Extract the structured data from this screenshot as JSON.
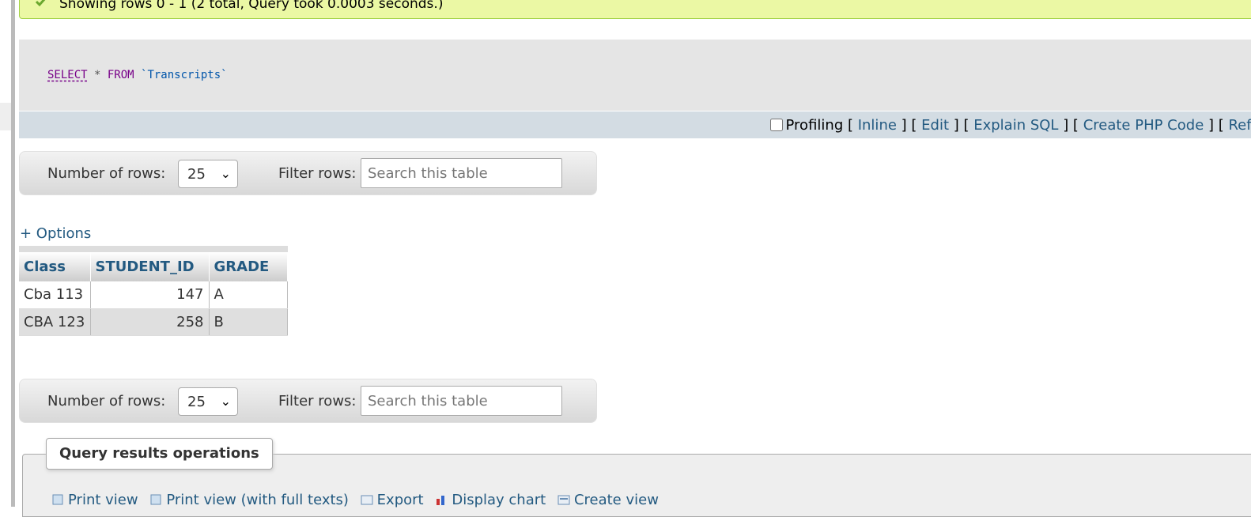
{
  "success": {
    "message": "Showing rows 0 - 1 (2 total, Query took 0.0003 seconds.)"
  },
  "sql": {
    "select": "SELECT",
    "star": " * ",
    "from": "FROM",
    "table": " `Transcripts`"
  },
  "tools": {
    "profiling": "Profiling",
    "inline": "Inline",
    "edit": "Edit",
    "explain": "Explain SQL",
    "php": "Create PHP Code",
    "refresh": "Refr"
  },
  "nav_top": {
    "rows_label": "Number of rows:",
    "rows_value": "25",
    "filter_label": "Filter rows:",
    "search_placeholder": "Search this table"
  },
  "nav_bottom": {
    "rows_label": "Number of rows:",
    "rows_value": "25",
    "filter_label": "Filter rows:",
    "search_placeholder": "Search this table"
  },
  "options_label": "+ Options",
  "table": {
    "headers": [
      "Class",
      "STUDENT_ID",
      "GRADE"
    ],
    "rows": [
      [
        "Cba 113",
        "147",
        "A"
      ],
      [
        "CBA 123",
        "258",
        "B"
      ]
    ]
  },
  "operations": {
    "title": "Query results operations",
    "links": [
      "Print view",
      "Print view (with full texts)",
      "Export",
      "Display chart",
      "Create view"
    ]
  },
  "colors": {
    "link": "#235a81",
    "success_bg": "#ebf8a4",
    "sql_bg": "#e5e5e5",
    "tools_bg": "#d3dce3"
  }
}
